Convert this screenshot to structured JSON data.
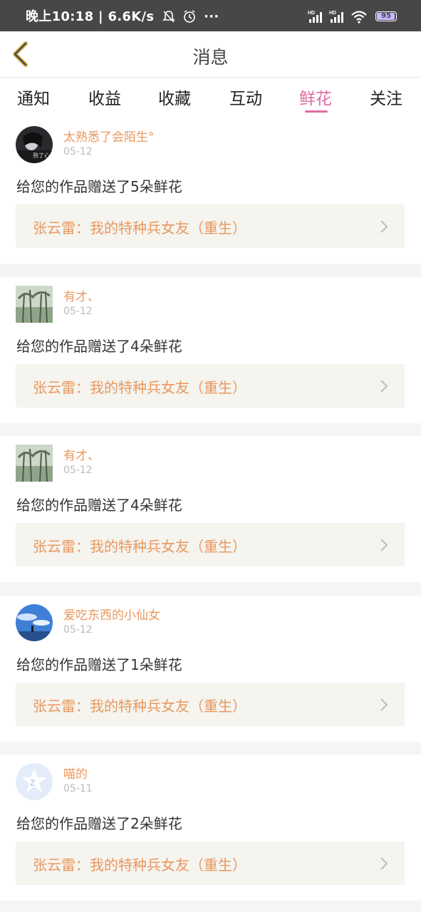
{
  "status_bar": {
    "time": "晚上10:18",
    "speed": "6.6K/s",
    "more": "···",
    "signal_label_1": "HD",
    "signal_label_2": "HD",
    "battery": "95"
  },
  "header": {
    "title": "消息",
    "back_icon": "back-chevron-icon"
  },
  "tabs": [
    {
      "label": "通知",
      "active": false
    },
    {
      "label": "收益",
      "active": false
    },
    {
      "label": "收藏",
      "active": false
    },
    {
      "label": "互动",
      "active": false
    },
    {
      "label": "鲜花",
      "active": true
    },
    {
      "label": "关注",
      "active": false
    }
  ],
  "colors": {
    "accent": "#e06ca0",
    "name": "#e8985f",
    "status_bar": "#474747"
  },
  "messages": [
    {
      "user": "太熟悉了会陌生°",
      "date": "05-12",
      "text": "给您的作品赠送了5朵鲜花",
      "work": "张云雷：我的特种兵女友（重生）",
      "avatar_caption": "熟了心"
    },
    {
      "user": "有才、",
      "date": "05-12",
      "text": "给您的作品赠送了4朵鲜花",
      "work": "张云雷：我的特种兵女友（重生）"
    },
    {
      "user": "有才、",
      "date": "05-12",
      "text": "给您的作品赠送了4朵鲜花",
      "work": "张云雷：我的特种兵女友（重生）"
    },
    {
      "user": "爱吃东西的小仙女",
      "date": "05-12",
      "text": "给您的作品赠送了1朵鲜花",
      "work": "张云雷：我的特种兵女友（重生）"
    },
    {
      "user": "喵的",
      "date": "05-11",
      "text": "给您的作品赠送了2朵鲜花",
      "work": "张云雷：我的特种兵女友（重生）"
    }
  ]
}
